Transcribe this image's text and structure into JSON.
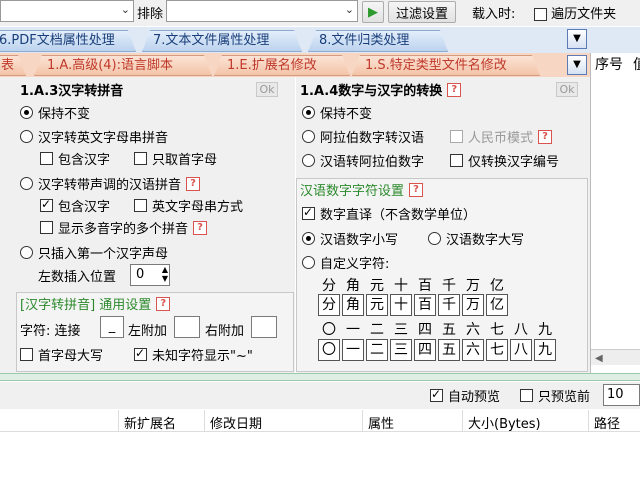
{
  "toolbar": {
    "exclude_label": "排除",
    "filter_button": "过滤设置",
    "load_label": "载入时:",
    "traverse_label": "遍历文件夹"
  },
  "tabs_main": [
    "6.PDF文档属性处理",
    "7.文本文件属性处理",
    "8.文件归类处理"
  ],
  "tabs_sub": [
    "表",
    "1.A.高级(4):语言脚本",
    "1.E.扩展名修改",
    "1.S.特定类型文件名修改"
  ],
  "left": {
    "title": "1.A.3汉字转拼音",
    "ok": "Ok",
    "opt_keep": "保持不变",
    "opt_letters": "汉字转英文字母串拼音",
    "cb_include_hanzi": "包含汉字",
    "cb_initial_only": "只取首字母",
    "opt_tone": "汉字转带声调的汉语拼音",
    "q": "?",
    "cb_include_hanzi2": "包含汉字",
    "cb_letter_mode": "英文字母串方式",
    "cb_multi": "显示多音字的多个拼音",
    "opt_initial": "只插入第一个汉字声母",
    "left_pos_label": "左数插入位置",
    "left_pos_value": "0",
    "group_title": "[汉字转拼音] 通用设置",
    "char_label": "字符: 连接",
    "conn_value": "_",
    "left_add": "左附加",
    "right_add": "右附加",
    "cb_cap": "首字母大写",
    "cb_unknown": "未知字符显示\"~\""
  },
  "right": {
    "title": "1.A.4数字与汉字的转换",
    "ok": "Ok",
    "opt_keep": "保持不变",
    "opt_arabic": "阿拉伯数字转汉语",
    "cb_rmb": "人民币模式",
    "opt_cn": "汉语转阿拉伯数字",
    "cb_only_num": "仅转换汉字编号",
    "group_title": "汉语数字字符设置",
    "cb_literal": "数字直译（不含数学单位）",
    "opt_lower": "汉语数字小写",
    "opt_upper": "汉语数字大写",
    "opt_custom": "自定义字符:",
    "row1": [
      "分",
      "角",
      "元",
      "十",
      "百",
      "千",
      "万",
      "亿"
    ],
    "row2": [
      "分",
      "角",
      "元",
      "十",
      "百",
      "千",
      "万",
      "亿"
    ],
    "row3": [
      "〇",
      "一",
      "二",
      "三",
      "四",
      "五",
      "六",
      "七",
      "八",
      "九"
    ],
    "row4": [
      "〇",
      "一",
      "二",
      "三",
      "四",
      "五",
      "六",
      "七",
      "八",
      "九"
    ]
  },
  "side": {
    "seq": "序号",
    "extra": "值"
  },
  "preview": {
    "auto": "自动预览",
    "only": "只预览前",
    "count": "10"
  },
  "table": {
    "cols": [
      "新扩展名",
      "修改日期",
      "属性",
      "大小(Bytes)",
      "路径"
    ]
  }
}
